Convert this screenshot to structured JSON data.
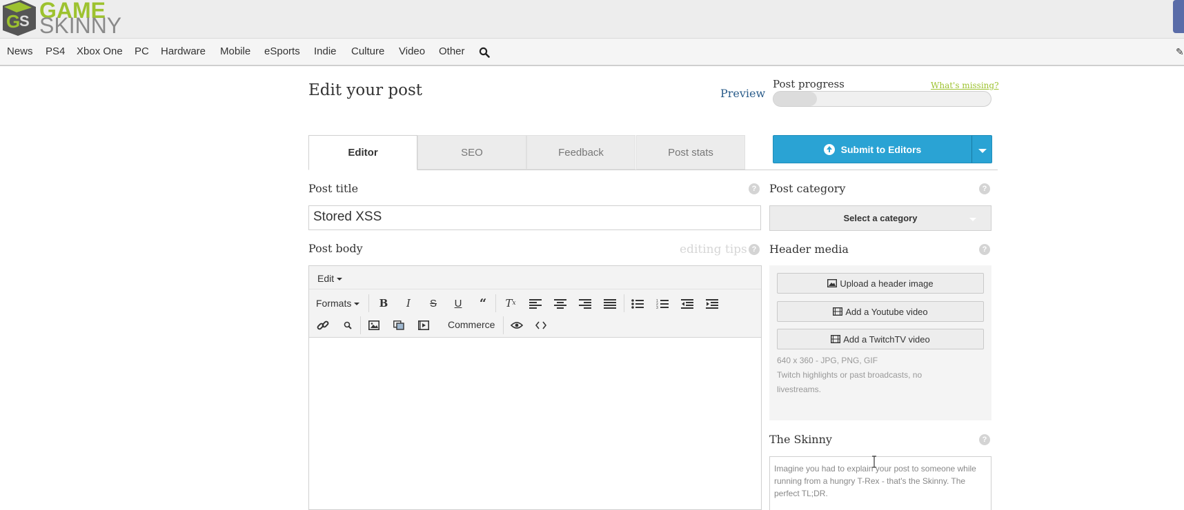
{
  "site": {
    "logo_game": "GAME",
    "logo_skinny": "SKINNY",
    "logo_mark": "GS"
  },
  "nav": {
    "items": [
      "News",
      "PS4",
      "Xbox One",
      "PC",
      "Hardware",
      "Mobile",
      "eSports",
      "Indie",
      "Culture",
      "Video",
      "Other"
    ],
    "search_icon": "search-icon",
    "pencil_icon": "pencil-icon"
  },
  "page": {
    "title": "Edit your post",
    "preview": "Preview",
    "progress_label": "Post progress",
    "whats_missing": "What's missing?",
    "progress_fraction": 0.2
  },
  "tabs": [
    "Editor",
    "SEO",
    "Feedback",
    "Post stats"
  ],
  "active_tab": "Editor",
  "submit": {
    "label": "Submit to Editors"
  },
  "post_title": {
    "label": "Post title",
    "value": "Stored XSS"
  },
  "post_body": {
    "label": "Post body",
    "editing_tips": "editing tips",
    "menu": "Edit",
    "formats": "Formats",
    "commerce": "Commerce"
  },
  "category": {
    "label": "Post category",
    "select": "Select a category"
  },
  "header_media": {
    "label": "Header media",
    "upload": "Upload a header image",
    "youtube": "Add a Youtube video",
    "twitch": "Add a TwitchTV video",
    "note_size": "640 x 360 - JPG, PNG, GIF",
    "note_twitch": "Twitch highlights or past broadcasts, no livestreams."
  },
  "skinny": {
    "label": "The Skinny",
    "placeholder": "Imagine you had to explain your post to someone while running from a hungry T-Rex - that's the Skinny. The perfect TL;DR."
  },
  "colors": {
    "brand_green": "#9dc22f",
    "accent_blue": "#2aa3d4",
    "link_blue": "#2a5c8a"
  }
}
